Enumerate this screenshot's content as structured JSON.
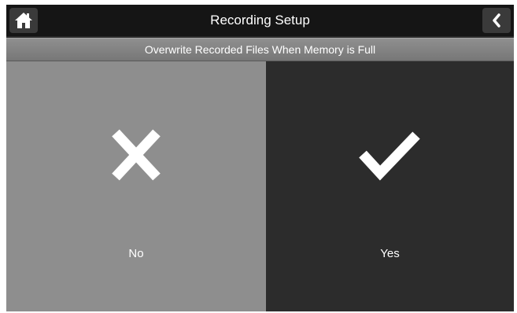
{
  "header": {
    "title": "Recording Setup",
    "home_icon": "home-icon",
    "back_icon": "chevron-left-icon"
  },
  "prompt": {
    "text": "Overwrite Recorded Files When Memory is Full"
  },
  "options": [
    {
      "label": "No",
      "icon": "cross-icon",
      "selected": false
    },
    {
      "label": "Yes",
      "icon": "checkmark-icon",
      "selected": true
    }
  ],
  "colors": {
    "topbar": "#151515",
    "subtitle_bar": "#858585",
    "option_no_bg": "#8e8e8e",
    "option_yes_bg": "#2c2c2c",
    "text": "#ffffff"
  }
}
